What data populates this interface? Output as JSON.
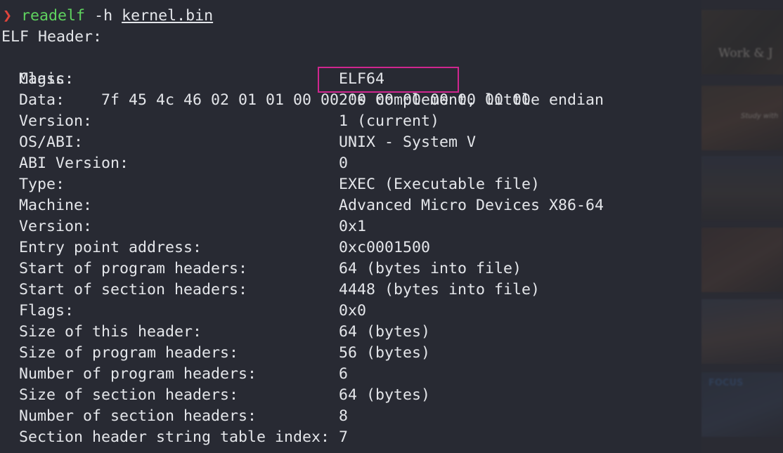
{
  "prompt": {
    "symbol": "❯",
    "command": "readelf",
    "flag": "-h",
    "file": "kernel.bin"
  },
  "header_title": "ELF Header:",
  "magic": {
    "label": "Magic:",
    "value": "7f 45 4c 46 02 01 01 00 00 00 00 00 00 00 00 00"
  },
  "fields": [
    {
      "label": "Class:",
      "value": "ELF64"
    },
    {
      "label": "Data:",
      "value": "2's complement, little endian"
    },
    {
      "label": "Version:",
      "value": "1 (current)"
    },
    {
      "label": "OS/ABI:",
      "value": "UNIX - System V"
    },
    {
      "label": "ABI Version:",
      "value": "0"
    },
    {
      "label": "Type:",
      "value": "EXEC (Executable file)"
    },
    {
      "label": "Machine:",
      "value": "Advanced Micro Devices X86-64"
    },
    {
      "label": "Version:",
      "value": "0x1"
    },
    {
      "label": "Entry point address:",
      "value": "0xc0001500"
    },
    {
      "label": "Start of program headers:",
      "value": "64 (bytes into file)"
    },
    {
      "label": "Start of section headers:",
      "value": "4448 (bytes into file)"
    },
    {
      "label": "Flags:",
      "value": "0x0"
    },
    {
      "label": "Size of this header:",
      "value": "64 (bytes)"
    },
    {
      "label": "Size of program headers:",
      "value": "56 (bytes)"
    },
    {
      "label": "Number of program headers:",
      "value": "6"
    },
    {
      "label": "Size of section headers:",
      "value": "64 (bytes)"
    },
    {
      "label": "Number of section headers:",
      "value": "8"
    },
    {
      "label": "Section header string table index:",
      "value": "7"
    }
  ],
  "sidebar": {
    "captions": [
      "Work & J",
      "Study with",
      "FOCUS"
    ]
  },
  "colors": {
    "background": "#282a33",
    "text": "#e4e6ea",
    "prompt_symbol": "#e0443c",
    "command": "#5fd35f",
    "highlight_box": "#d0268f"
  }
}
